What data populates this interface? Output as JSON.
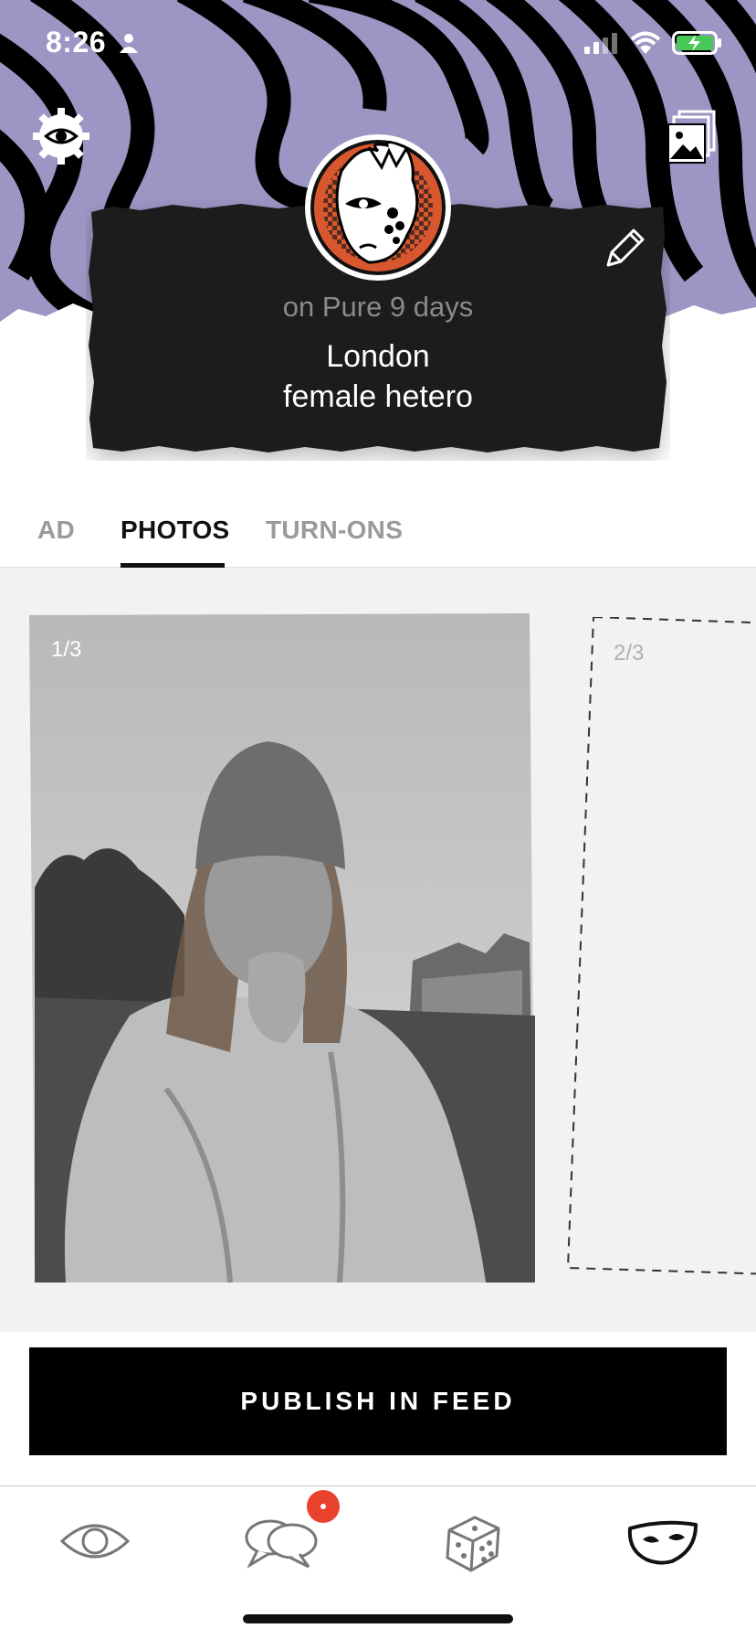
{
  "status_bar": {
    "time": "8:26",
    "icons": [
      "person-icon",
      "signal-icon",
      "wifi-icon",
      "battery-charging-icon"
    ]
  },
  "header": {
    "background_colors": {
      "purple": "#9b96c3",
      "black": "#000000"
    },
    "settings_icon": "settings-eye-icon",
    "gallery_icon": "gallery-icon"
  },
  "profile": {
    "days_on_app": "on Pure 9 days",
    "city": "London",
    "orientation": "female hetero",
    "edit_icon": "pencil-icon",
    "avatar_icon": "mask-face-avatar"
  },
  "tabs": [
    {
      "label": "AD",
      "active": false
    },
    {
      "label": "PHOTOS",
      "active": true
    },
    {
      "label": "TURN-ONS",
      "active": false
    }
  ],
  "photos": {
    "items": [
      {
        "label": "1/3"
      },
      {
        "label": "2/3"
      }
    ]
  },
  "publish_button": {
    "label": "PUBLISH IN FEED"
  },
  "bottom_nav": {
    "items": [
      {
        "icon": "eye-icon"
      },
      {
        "icon": "chat-icon",
        "badge": true
      },
      {
        "icon": "dice-icon"
      },
      {
        "icon": "mask-icon",
        "active": true
      }
    ],
    "badge_color": "#e8412e"
  }
}
